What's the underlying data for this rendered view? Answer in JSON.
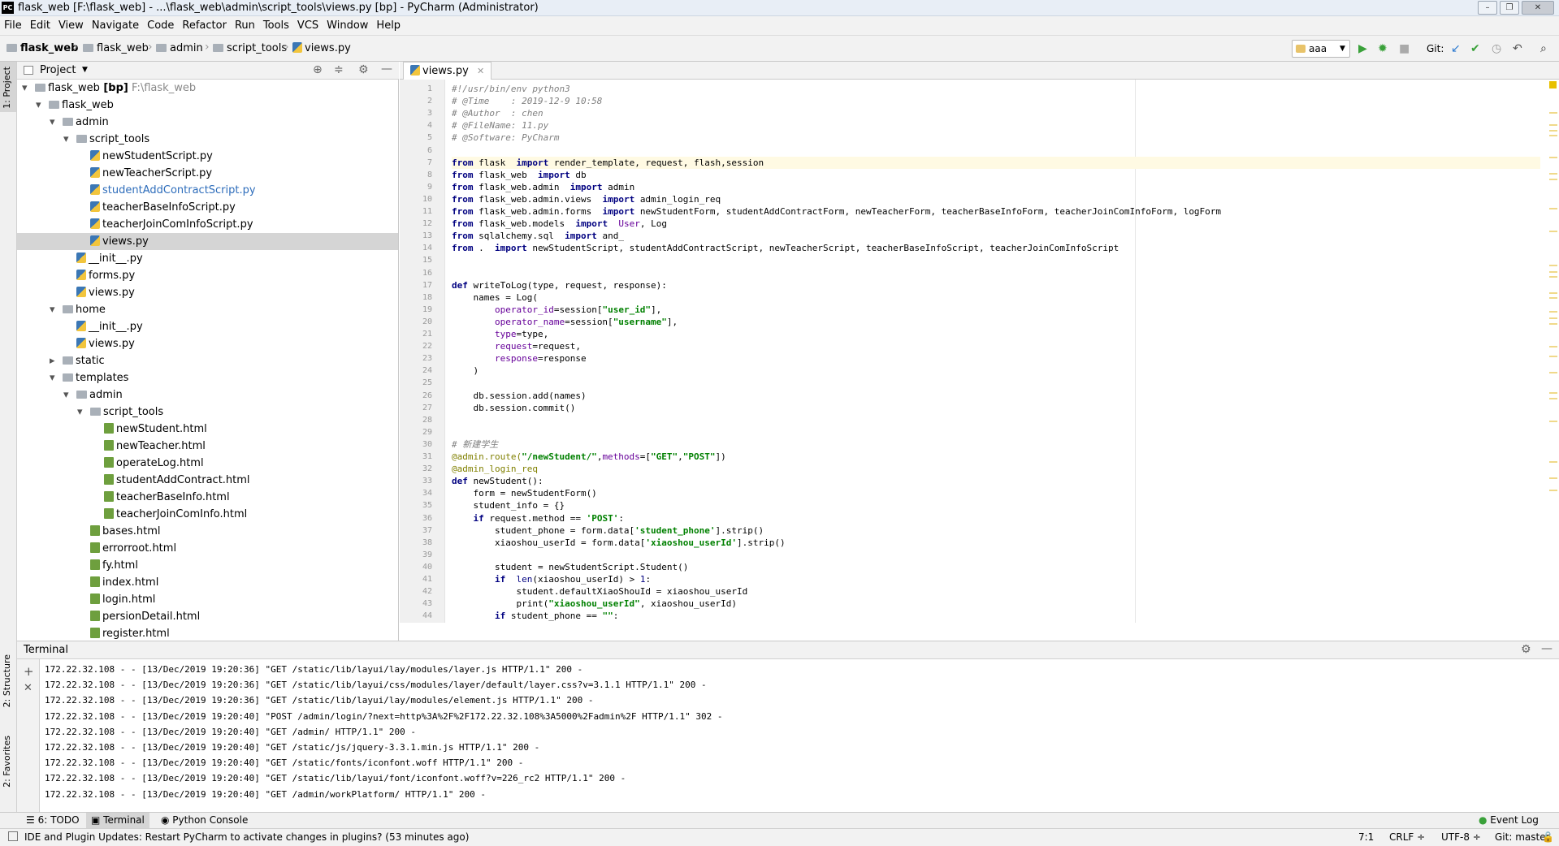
{
  "window": {
    "title": "flask_web [F:\\flask_web] - ...\\flask_web\\admin\\script_tools\\views.py [bp] - PyCharm (Administrator)"
  },
  "menu": [
    "File",
    "Edit",
    "View",
    "Navigate",
    "Code",
    "Refactor",
    "Run",
    "Tools",
    "VCS",
    "Window",
    "Help"
  ],
  "breadcrumb": [
    "flask_web",
    "flask_web",
    "admin",
    "script_tools",
    "views.py"
  ],
  "toolbar": {
    "run_config": "aaa",
    "git_label": "Git:"
  },
  "project_panel": {
    "title": "Project",
    "tree": [
      {
        "label": "flask_web",
        "bold": " [bp]",
        "suffix": "F:\\flask_web",
        "depth": 0,
        "type": "folder",
        "open": true
      },
      {
        "label": "flask_web",
        "depth": 1,
        "type": "folder",
        "open": true
      },
      {
        "label": "admin",
        "depth": 2,
        "type": "folder",
        "open": true
      },
      {
        "label": "script_tools",
        "depth": 3,
        "type": "folder",
        "open": true
      },
      {
        "label": "newStudentScript.py",
        "depth": 4,
        "type": "py"
      },
      {
        "label": "newTeacherScript.py",
        "depth": 4,
        "type": "py"
      },
      {
        "label": "studentAddContractScript.py",
        "depth": 4,
        "type": "py",
        "modified": true
      },
      {
        "label": "teacherBaseInfoScript.py",
        "depth": 4,
        "type": "py"
      },
      {
        "label": "teacherJoinComInfoScript.py",
        "depth": 4,
        "type": "py"
      },
      {
        "label": "views.py",
        "depth": 4,
        "type": "py",
        "selected": true
      },
      {
        "label": "__init__.py",
        "depth": 3,
        "type": "py"
      },
      {
        "label": "forms.py",
        "depth": 3,
        "type": "py"
      },
      {
        "label": "views.py",
        "depth": 3,
        "type": "py"
      },
      {
        "label": "home",
        "depth": 2,
        "type": "folder",
        "open": true
      },
      {
        "label": "__init__.py",
        "depth": 3,
        "type": "py"
      },
      {
        "label": "views.py",
        "depth": 3,
        "type": "py"
      },
      {
        "label": "static",
        "depth": 2,
        "type": "folder",
        "open": false
      },
      {
        "label": "templates",
        "depth": 2,
        "type": "folder",
        "open": true
      },
      {
        "label": "admin",
        "depth": 3,
        "type": "folder",
        "open": true
      },
      {
        "label": "script_tools",
        "depth": 4,
        "type": "folder",
        "open": true
      },
      {
        "label": "newStudent.html",
        "depth": 5,
        "type": "html"
      },
      {
        "label": "newTeacher.html",
        "depth": 5,
        "type": "html"
      },
      {
        "label": "operateLog.html",
        "depth": 5,
        "type": "html"
      },
      {
        "label": "studentAddContract.html",
        "depth": 5,
        "type": "html"
      },
      {
        "label": "teacherBaseInfo.html",
        "depth": 5,
        "type": "html"
      },
      {
        "label": "teacherJoinComInfo.html",
        "depth": 5,
        "type": "html"
      },
      {
        "label": "bases.html",
        "depth": 4,
        "type": "html"
      },
      {
        "label": "errorroot.html",
        "depth": 4,
        "type": "html"
      },
      {
        "label": "fy.html",
        "depth": 4,
        "type": "html"
      },
      {
        "label": "index.html",
        "depth": 4,
        "type": "html"
      },
      {
        "label": "login.html",
        "depth": 4,
        "type": "html"
      },
      {
        "label": "persionDetail.html",
        "depth": 4,
        "type": "html"
      },
      {
        "label": "register.html",
        "depth": 4,
        "type": "html"
      }
    ]
  },
  "editor": {
    "tab": "views.py",
    "lines": [
      [
        [
          "cm",
          "#!/usr/bin/env python3"
        ]
      ],
      [
        [
          "cm",
          "# @Time    : 2019-12-9 10:58"
        ]
      ],
      [
        [
          "cm",
          "# @Author  : chen"
        ]
      ],
      [
        [
          "cm",
          "# @FileName: 11.py"
        ]
      ],
      [
        [
          "cm",
          "# @Software: PyCharm"
        ]
      ],
      [],
      [
        [
          "kw",
          "from"
        ],
        [
          "",
          "flask "
        ],
        [
          "kw",
          "import"
        ],
        [
          "",
          "render_template, request, flash,session"
        ]
      ],
      [
        [
          "kw",
          "from"
        ],
        [
          "",
          "flask_web "
        ],
        [
          "kw",
          "import"
        ],
        [
          "",
          "db"
        ]
      ],
      [
        [
          "kw",
          "from"
        ],
        [
          "",
          "flask_web.admin "
        ],
        [
          "kw",
          "import"
        ],
        [
          "",
          "admin"
        ]
      ],
      [
        [
          "kw",
          "from"
        ],
        [
          "",
          "flask_web.admin.views "
        ],
        [
          "kw",
          "import"
        ],
        [
          "",
          "admin_login_req"
        ]
      ],
      [
        [
          "kw",
          "from"
        ],
        [
          "",
          "flask_web.admin.forms "
        ],
        [
          "kw",
          "import"
        ],
        [
          "",
          "newStudentForm, studentAddContractForm, newTeacherForm, teacherBaseInfoForm, teacherJoinComInfoForm, logForm"
        ]
      ],
      [
        [
          "kw",
          "from"
        ],
        [
          "",
          "flask_web.models "
        ],
        [
          "kw",
          "import"
        ],
        [
          "pa",
          " User"
        ],
        [
          "",
          ", Log"
        ]
      ],
      [
        [
          "kw",
          "from"
        ],
        [
          "",
          "sqlalchemy.sql "
        ],
        [
          "kw",
          "import"
        ],
        [
          "",
          "and_"
        ]
      ],
      [
        [
          "kw",
          "from"
        ],
        [
          "",
          ". "
        ],
        [
          "kw",
          "import"
        ],
        [
          "",
          "newStudentScript, studentAddContractScript, newTeacherScript, teacherBaseInfoScript, teacherJoinComInfoScript"
        ]
      ],
      [],
      [],
      [
        [
          "kw",
          "def"
        ],
        [
          "",
          "writeToLog(type, request, response):"
        ]
      ],
      [
        [
          "",
          "    names = Log("
        ]
      ],
      [
        [
          "pa",
          "        operator_id"
        ],
        [
          "",
          "=session["
        ],
        [
          "st",
          "\"user_id\""
        ],
        [
          "",
          "],"
        ]
      ],
      [
        [
          "pa",
          "        operator_name"
        ],
        [
          "",
          "=session["
        ],
        [
          "st",
          "\"username\""
        ],
        [
          "",
          "],"
        ]
      ],
      [
        [
          "pa",
          "        type"
        ],
        [
          "",
          "=type,"
        ]
      ],
      [
        [
          "pa",
          "        request"
        ],
        [
          "",
          "=request,"
        ]
      ],
      [
        [
          "pa",
          "        response"
        ],
        [
          "",
          "=response"
        ]
      ],
      [
        [
          "",
          "    )"
        ]
      ],
      [],
      [
        [
          "",
          "    db.session.add(names)"
        ]
      ],
      [
        [
          "",
          "    db.session.commit()"
        ]
      ],
      [],
      [],
      [
        [
          "cm",
          "# 新建学生"
        ]
      ],
      [
        [
          "dc",
          "@admin.route("
        ],
        [
          "st",
          "\"/newStudent/\""
        ],
        [
          "",
          ","
        ],
        [
          "pa",
          "methods"
        ],
        [
          "",
          "=["
        ],
        [
          "st",
          "\"GET\""
        ],
        [
          "",
          ","
        ],
        [
          "st",
          "\"POST\""
        ],
        [
          "",
          "])"
        ]
      ],
      [
        [
          "dc",
          "@admin_login_req"
        ]
      ],
      [
        [
          "kw",
          "def"
        ],
        [
          "",
          "newStudent():"
        ]
      ],
      [
        [
          "",
          "    form = newStudentForm()"
        ]
      ],
      [
        [
          "",
          "    student_info = {}"
        ]
      ],
      [
        [
          "kw",
          "    if"
        ],
        [
          "",
          "request.method == "
        ],
        [
          "st",
          "'POST'"
        ],
        [
          "",
          ":"
        ]
      ],
      [
        [
          "",
          "        student_phone = form.data["
        ],
        [
          "st",
          "'student_phone'"
        ],
        [
          "",
          "].strip()"
        ]
      ],
      [
        [
          "",
          "        xiaoshou_userId = form.data["
        ],
        [
          "st",
          "'xiaoshou_userId'"
        ],
        [
          "",
          "].strip()"
        ]
      ],
      [],
      [
        [
          "",
          "        student = newStudentScript.Student()"
        ]
      ],
      [
        [
          "kw",
          "        if"
        ],
        [
          "bi",
          " len"
        ],
        [
          "",
          "(xiaoshou_userId) > "
        ],
        [
          "bi",
          "1"
        ],
        [
          "",
          ":"
        ]
      ],
      [
        [
          "",
          "            student.defaultXiaoShouId = xiaoshou_userId"
        ]
      ],
      [
        [
          "",
          "            print("
        ],
        [
          "st",
          "\"xiaoshou_userId\""
        ],
        [
          "",
          ", xiaoshou_userId)"
        ]
      ],
      [
        [
          "kw",
          "        if"
        ],
        [
          "",
          "student_phone == "
        ],
        [
          "st",
          "\"\""
        ],
        [
          "",
          ":"
        ]
      ]
    ]
  },
  "terminal": {
    "title": "Terminal",
    "lines": [
      "172.22.32.108 - - [13/Dec/2019 19:20:36] \"GET /static/lib/layui/lay/modules/layer.js HTTP/1.1\" 200 -",
      "172.22.32.108 - - [13/Dec/2019 19:20:36] \"GET /static/lib/layui/css/modules/layer/default/layer.css?v=3.1.1 HTTP/1.1\" 200 -",
      "172.22.32.108 - - [13/Dec/2019 19:20:36] \"GET /static/lib/layui/lay/modules/element.js HTTP/1.1\" 200 -",
      "172.22.32.108 - - [13/Dec/2019 19:20:40] \"POST /admin/login/?next=http%3A%2F%2F172.22.32.108%3A5000%2Fadmin%2F HTTP/1.1\" 302 -",
      "172.22.32.108 - - [13/Dec/2019 19:20:40] \"GET /admin/ HTTP/1.1\" 200 -",
      "172.22.32.108 - - [13/Dec/2019 19:20:40] \"GET /static/js/jquery-3.3.1.min.js HTTP/1.1\" 200 -",
      "172.22.32.108 - - [13/Dec/2019 19:20:40] \"GET /static/fonts/iconfont.woff HTTP/1.1\" 200 -",
      "172.22.32.108 - - [13/Dec/2019 19:20:40] \"GET /static/lib/layui/font/iconfont.woff?v=226_rc2 HTTP/1.1\" 200 -",
      "172.22.32.108 - - [13/Dec/2019 19:20:40] \"GET /admin/workPlatform/ HTTP/1.1\" 200 -"
    ]
  },
  "sidebar_tabs": {
    "project": "1: Project",
    "structure": "2: Structure",
    "favorites": "2: Favorites"
  },
  "bottom_tabs": {
    "todo": "6: TODO",
    "terminal": "Terminal",
    "python_console": "Python Console",
    "event_log": "Event Log"
  },
  "status": {
    "message": "IDE and Plugin Updates: Restart PyCharm to activate changes in plugins? (53 minutes ago)",
    "position": "7:1",
    "line_sep": "CRLF ÷",
    "encoding": "UTF-8 ÷",
    "git": "Git: master ÷"
  },
  "colors": {
    "accent": "#3b77b5",
    "selection": "#d5d5d5",
    "keyword": "#000080",
    "string": "#008000",
    "comment": "#808080"
  }
}
